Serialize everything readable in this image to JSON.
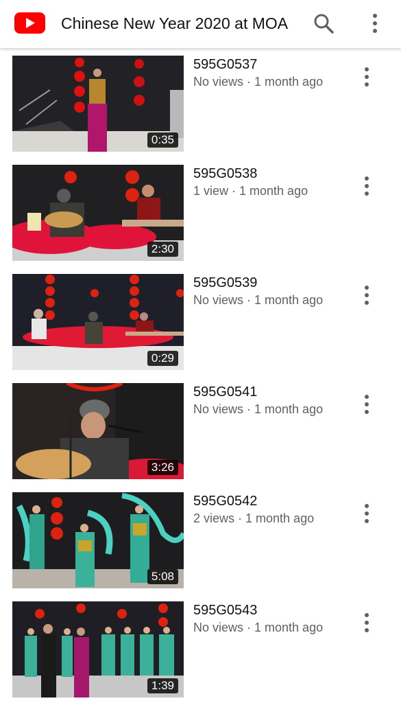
{
  "app_bar": {
    "title": "Chinese New Year 2020 at MOA",
    "logo_icon": "youtube-logo-icon",
    "search_icon": "search-icon",
    "menu_icon": "more-vert-icon"
  },
  "colors": {
    "brand_red": "#ff0000",
    "text_primary": "#111111",
    "text_secondary": "#606060"
  },
  "videos": [
    {
      "title": "595G0537",
      "meta": "No views · 1 month ago",
      "duration": "0:35"
    },
    {
      "title": "595G0538",
      "meta": "1 view · 1 month ago",
      "duration": "2:30"
    },
    {
      "title": "595G0539",
      "meta": "No views · 1 month ago",
      "duration": "0:29"
    },
    {
      "title": "595G0541",
      "meta": "No views · 1 month ago",
      "duration": "3:26"
    },
    {
      "title": "595G0542",
      "meta": "2 views · 1 month ago",
      "duration": "5:08"
    },
    {
      "title": "595G0543",
      "meta": "No views · 1 month ago",
      "duration": "1:39"
    }
  ]
}
